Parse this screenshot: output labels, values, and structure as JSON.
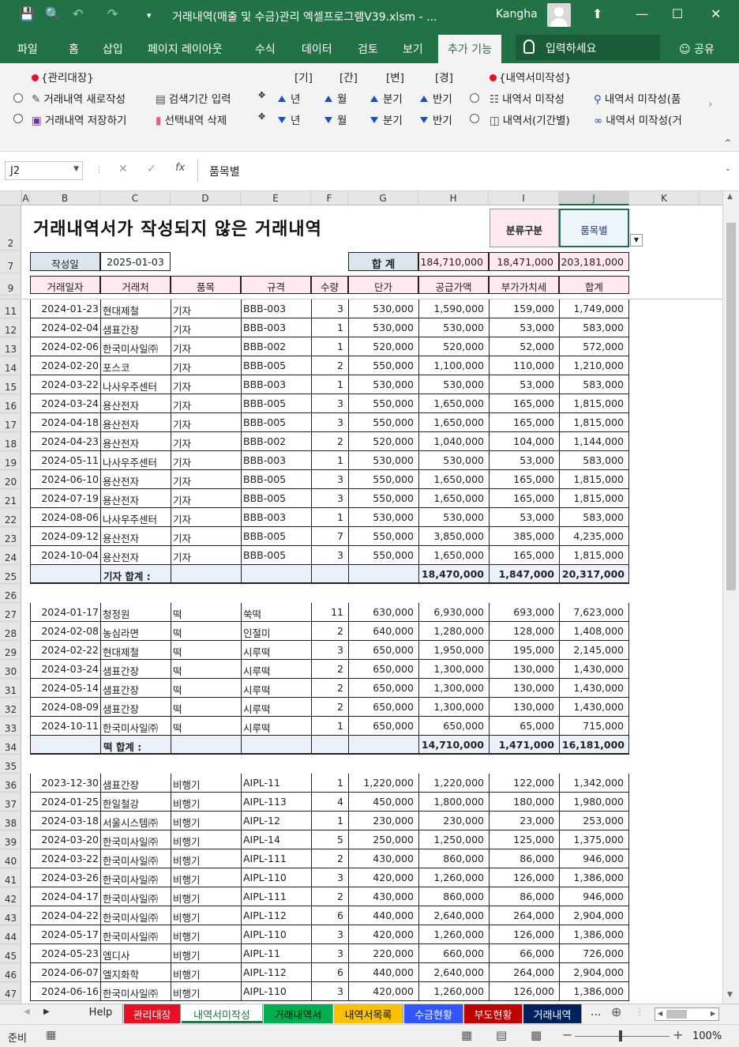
{
  "window": {
    "document_title": "거래내역(매출 및 수금)관리 엑셀프로그램V39.xlsm  -  ...",
    "user": "Kangha"
  },
  "ribbon_tabs": [
    "파일",
    "홈",
    "삽입",
    "페이지 레이아웃",
    "수식",
    "데이터",
    "검토",
    "보기",
    "추가 기능"
  ],
  "active_tab": "추가 기능",
  "tell_me": "입력하세요",
  "share": "공유",
  "ribbon": {
    "group1_label": "{관리대장}",
    "group2_label": "{내역서미작성}",
    "new_entry": "거래내역 새로작성",
    "save_entry": "거래내역 저장하기",
    "period_input": "검색기간 입력",
    "delete_selected": "선택내역 삭제",
    "period_headers": [
      "[기]",
      "[간]",
      "[변]",
      "[경]"
    ],
    "up_labels": [
      "년",
      "월",
      "분기",
      "반기"
    ],
    "down_labels": [
      "년",
      "월",
      "분기",
      "반기"
    ],
    "unwritten": "내역서 미작성",
    "unwritten_period": "내역서(기간별)",
    "unwritten_item": "내역서 미작성(품",
    "unwritten_client": "내역서 미작성(거"
  },
  "formula_bar": {
    "name_box": "J2",
    "fx": "fx",
    "content": "품목별"
  },
  "columns": [
    "A",
    "B",
    "C",
    "D",
    "E",
    "F",
    "G",
    "H",
    "I",
    "J",
    "K"
  ],
  "sheet": {
    "title": "거래내역서가 작성되지 않은 거래내역",
    "btn_category": "분류구분",
    "btn_item": "품목별",
    "date_label": "작성일",
    "date_value": "2025-01-03",
    "total_label": "합  계",
    "total_supply": "184,710,000",
    "total_vat": "18,471,000",
    "total_sum": "203,181,000",
    "headers": [
      "거래일자",
      "거래처",
      "품목",
      "규격",
      "수량",
      "단가",
      "공급가액",
      "부가가치세",
      "합계"
    ]
  },
  "groups": [
    {
      "rows": [
        {
          "r": "11",
          "date": "2024-01-23",
          "client": "현대제철",
          "item": "기자",
          "spec": "BBB-003",
          "qty": "3",
          "price": "530,000",
          "supply": "1,590,000",
          "vat": "159,000",
          "sum": "1,749,000"
        },
        {
          "r": "12",
          "date": "2024-02-04",
          "client": "샘표간장",
          "item": "기자",
          "spec": "BBB-003",
          "qty": "1",
          "price": "530,000",
          "supply": "530,000",
          "vat": "53,000",
          "sum": "583,000"
        },
        {
          "r": "13",
          "date": "2024-02-06",
          "client": "한국미사일㈜",
          "item": "기자",
          "spec": "BBB-002",
          "qty": "1",
          "price": "520,000",
          "supply": "520,000",
          "vat": "52,000",
          "sum": "572,000"
        },
        {
          "r": "14",
          "date": "2024-02-20",
          "client": "포스코",
          "item": "기자",
          "spec": "BBB-005",
          "qty": "2",
          "price": "550,000",
          "supply": "1,100,000",
          "vat": "110,000",
          "sum": "1,210,000"
        },
        {
          "r": "15",
          "date": "2024-03-22",
          "client": "나사우주센터",
          "item": "기자",
          "spec": "BBB-003",
          "qty": "1",
          "price": "530,000",
          "supply": "530,000",
          "vat": "53,000",
          "sum": "583,000"
        },
        {
          "r": "16",
          "date": "2024-03-24",
          "client": "용산전자",
          "item": "기자",
          "spec": "BBB-005",
          "qty": "3",
          "price": "550,000",
          "supply": "1,650,000",
          "vat": "165,000",
          "sum": "1,815,000"
        },
        {
          "r": "17",
          "date": "2024-04-18",
          "client": "용산전자",
          "item": "기자",
          "spec": "BBB-005",
          "qty": "3",
          "price": "550,000",
          "supply": "1,650,000",
          "vat": "165,000",
          "sum": "1,815,000"
        },
        {
          "r": "18",
          "date": "2024-04-23",
          "client": "용산전자",
          "item": "기자",
          "spec": "BBB-002",
          "qty": "2",
          "price": "520,000",
          "supply": "1,040,000",
          "vat": "104,000",
          "sum": "1,144,000"
        },
        {
          "r": "19",
          "date": "2024-05-11",
          "client": "나사우주센터",
          "item": "기자",
          "spec": "BBB-003",
          "qty": "1",
          "price": "530,000",
          "supply": "530,000",
          "vat": "53,000",
          "sum": "583,000"
        },
        {
          "r": "20",
          "date": "2024-06-10",
          "client": "용산전자",
          "item": "기자",
          "spec": "BBB-005",
          "qty": "3",
          "price": "550,000",
          "supply": "1,650,000",
          "vat": "165,000",
          "sum": "1,815,000"
        },
        {
          "r": "21",
          "date": "2024-07-19",
          "client": "용산전자",
          "item": "기자",
          "spec": "BBB-005",
          "qty": "3",
          "price": "550,000",
          "supply": "1,650,000",
          "vat": "165,000",
          "sum": "1,815,000"
        },
        {
          "r": "22",
          "date": "2024-08-06",
          "client": "나사우주센터",
          "item": "기자",
          "spec": "BBB-003",
          "qty": "1",
          "price": "530,000",
          "supply": "530,000",
          "vat": "53,000",
          "sum": "583,000"
        },
        {
          "r": "23",
          "date": "2024-09-12",
          "client": "용산전자",
          "item": "기자",
          "spec": "BBB-005",
          "qty": "7",
          "price": "550,000",
          "supply": "3,850,000",
          "vat": "385,000",
          "sum": "4,235,000"
        },
        {
          "r": "24",
          "date": "2024-10-04",
          "client": "용산전자",
          "item": "기자",
          "spec": "BBB-005",
          "qty": "3",
          "price": "550,000",
          "supply": "1,650,000",
          "vat": "165,000",
          "sum": "1,815,000"
        }
      ],
      "subtotal": {
        "r": "25",
        "label": "기자 합계  :",
        "supply": "18,470,000",
        "vat": "1,847,000",
        "sum": "20,317,000"
      },
      "blank": "26"
    },
    {
      "rows": [
        {
          "r": "27",
          "date": "2024-01-17",
          "client": "청정원",
          "item": "떡",
          "spec": "쑥떡",
          "qty": "11",
          "price": "630,000",
          "supply": "6,930,000",
          "vat": "693,000",
          "sum": "7,623,000"
        },
        {
          "r": "28",
          "date": "2024-02-08",
          "client": "농심라면",
          "item": "떡",
          "spec": "인절미",
          "qty": "2",
          "price": "640,000",
          "supply": "1,280,000",
          "vat": "128,000",
          "sum": "1,408,000"
        },
        {
          "r": "29",
          "date": "2024-02-22",
          "client": "현대제철",
          "item": "떡",
          "spec": "시루떡",
          "qty": "3",
          "price": "650,000",
          "supply": "1,950,000",
          "vat": "195,000",
          "sum": "2,145,000"
        },
        {
          "r": "30",
          "date": "2024-03-24",
          "client": "샘표간장",
          "item": "떡",
          "spec": "시루떡",
          "qty": "2",
          "price": "650,000",
          "supply": "1,300,000",
          "vat": "130,000",
          "sum": "1,430,000"
        },
        {
          "r": "31",
          "date": "2024-05-14",
          "client": "샘표간장",
          "item": "떡",
          "spec": "시루떡",
          "qty": "2",
          "price": "650,000",
          "supply": "1,300,000",
          "vat": "130,000",
          "sum": "1,430,000"
        },
        {
          "r": "32",
          "date": "2024-08-09",
          "client": "샘표간장",
          "item": "떡",
          "spec": "시루떡",
          "qty": "2",
          "price": "650,000",
          "supply": "1,300,000",
          "vat": "130,000",
          "sum": "1,430,000"
        },
        {
          "r": "33",
          "date": "2024-10-11",
          "client": "한국미사일㈜",
          "item": "떡",
          "spec": "시루떡",
          "qty": "1",
          "price": "650,000",
          "supply": "650,000",
          "vat": "65,000",
          "sum": "715,000"
        }
      ],
      "subtotal": {
        "r": "34",
        "label": "떡 합계  :",
        "supply": "14,710,000",
        "vat": "1,471,000",
        "sum": "16,181,000"
      },
      "blank": "35"
    },
    {
      "rows": [
        {
          "r": "36",
          "date": "2023-12-30",
          "client": "샘표간장",
          "item": "비행기",
          "spec": "AIPL-11",
          "qty": "1",
          "price": "1,220,000",
          "supply": "1,220,000",
          "vat": "122,000",
          "sum": "1,342,000"
        },
        {
          "r": "37",
          "date": "2024-01-25",
          "client": "한일철강",
          "item": "비행기",
          "spec": "AIPL-113",
          "qty": "4",
          "price": "450,000",
          "supply": "1,800,000",
          "vat": "180,000",
          "sum": "1,980,000"
        },
        {
          "r": "38",
          "date": "2024-03-18",
          "client": "서울시스템㈜",
          "item": "비행기",
          "spec": "AIPL-12",
          "qty": "1",
          "price": "230,000",
          "supply": "230,000",
          "vat": "23,000",
          "sum": "253,000"
        },
        {
          "r": "39",
          "date": "2024-03-20",
          "client": "한국미사일㈜",
          "item": "비행기",
          "spec": "AIPL-14",
          "qty": "5",
          "price": "250,000",
          "supply": "1,250,000",
          "vat": "125,000",
          "sum": "1,375,000"
        },
        {
          "r": "40",
          "date": "2024-03-22",
          "client": "한국미사일㈜",
          "item": "비행기",
          "spec": "AIPL-111",
          "qty": "2",
          "price": "430,000",
          "supply": "860,000",
          "vat": "86,000",
          "sum": "946,000"
        },
        {
          "r": "41",
          "date": "2024-03-26",
          "client": "한국미사일㈜",
          "item": "비행기",
          "spec": "AIPL-110",
          "qty": "3",
          "price": "420,000",
          "supply": "1,260,000",
          "vat": "126,000",
          "sum": "1,386,000"
        },
        {
          "r": "42",
          "date": "2024-04-17",
          "client": "한국미사일㈜",
          "item": "비행기",
          "spec": "AIPL-111",
          "qty": "2",
          "price": "430,000",
          "supply": "860,000",
          "vat": "86,000",
          "sum": "946,000"
        },
        {
          "r": "43",
          "date": "2024-04-22",
          "client": "한국미사일㈜",
          "item": "비행기",
          "spec": "AIPL-112",
          "qty": "6",
          "price": "440,000",
          "supply": "2,640,000",
          "vat": "264,000",
          "sum": "2,904,000"
        },
        {
          "r": "44",
          "date": "2024-05-17",
          "client": "한국미사일㈜",
          "item": "비행기",
          "spec": "AIPL-110",
          "qty": "3",
          "price": "420,000",
          "supply": "1,260,000",
          "vat": "126,000",
          "sum": "1,386,000"
        },
        {
          "r": "45",
          "date": "2024-05-23",
          "client": "엠디사",
          "item": "비행기",
          "spec": "AIPL-11",
          "qty": "3",
          "price": "220,000",
          "supply": "660,000",
          "vat": "66,000",
          "sum": "726,000"
        },
        {
          "r": "46",
          "date": "2024-06-07",
          "client": "엘지화학",
          "item": "비행기",
          "spec": "AIPL-112",
          "qty": "6",
          "price": "440,000",
          "supply": "2,640,000",
          "vat": "264,000",
          "sum": "2,904,000"
        },
        {
          "r": "47",
          "date": "2024-06-16",
          "client": "한국미사일㈜",
          "item": "비행기",
          "spec": "AIPL-110",
          "qty": "3",
          "price": "420,000",
          "supply": "1,260,000",
          "vat": "126,000",
          "sum": "1,386,000"
        }
      ]
    }
  ],
  "sheet_tabs": [
    {
      "label": "Help",
      "bg": "#f0f0f0",
      "fg": "#222"
    },
    {
      "label": "관리대장",
      "bg": "#e81123",
      "fg": "#ffffff"
    },
    {
      "label": "내역서미작성",
      "bg": "#ffffff",
      "fg": "#217346"
    },
    {
      "label": "거래내역서",
      "bg": "#00b050",
      "fg": "#111111"
    },
    {
      "label": "내역서목록",
      "bg": "#ffc000",
      "fg": "#111111"
    },
    {
      "label": "수금현황",
      "bg": "#3355ff",
      "fg": "#ffffff"
    },
    {
      "label": "부도현황",
      "bg": "#c00000",
      "fg": "#ffffff"
    },
    {
      "label": "거래내역",
      "bg": "#002060",
      "fg": "#ffffff"
    }
  ],
  "more_tabs": "...",
  "status": {
    "ready": "준비",
    "zoom": "100%"
  },
  "colors": {
    "excel_green": "#217346",
    "header_pink": "#fde9ee",
    "header_blue": "#dce6f1",
    "subtotal_blue": "#eaf1fb",
    "border": "#222222"
  }
}
